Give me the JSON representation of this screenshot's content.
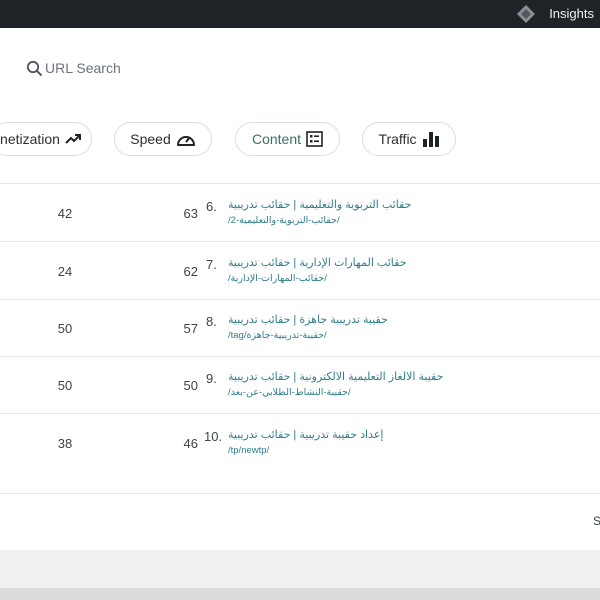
{
  "topbar": {
    "insights_label": "Insights"
  },
  "search": {
    "label": "URL Search"
  },
  "filters": {
    "monetization": "netization",
    "speed": "Speed",
    "content": "Content",
    "traffic": "Traffic"
  },
  "rows": [
    {
      "col_a": "42",
      "col_b": "63",
      "index": "6.",
      "title": "حقائب التربوية والتعليمية | حقائب تدريبية",
      "url": "/حقائب-التربوية-والتعليمية-2/"
    },
    {
      "col_a": "24",
      "col_b": "62",
      "index": "7.",
      "title": "حقائب المهارات الإدارية | حقائب تدريبية",
      "url": "/حقائب-المهارات-الإدارية/"
    },
    {
      "col_a": "50",
      "col_b": "57",
      "index": "8.",
      "title": "حقيبة تدريبية جاهزة | حقائب تدريبية",
      "url": "/tag/حقيبة-تدريبية-جاهزة/"
    },
    {
      "col_a": "50",
      "col_b": "50",
      "index": "9.",
      "title": "حقيبة الالغاز التعليمية الالكترونية | حقائب تدريبية",
      "url": "/حقيبة-النشاط-الطلابي-عن-بعد/"
    },
    {
      "col_a": "38",
      "col_b": "46",
      "index": "10.",
      "title": "إعداد حقيبة تدريبية | حقائب تدريبية",
      "url": "/tp/newtp/"
    }
  ],
  "footer": {
    "partial": "S"
  }
}
